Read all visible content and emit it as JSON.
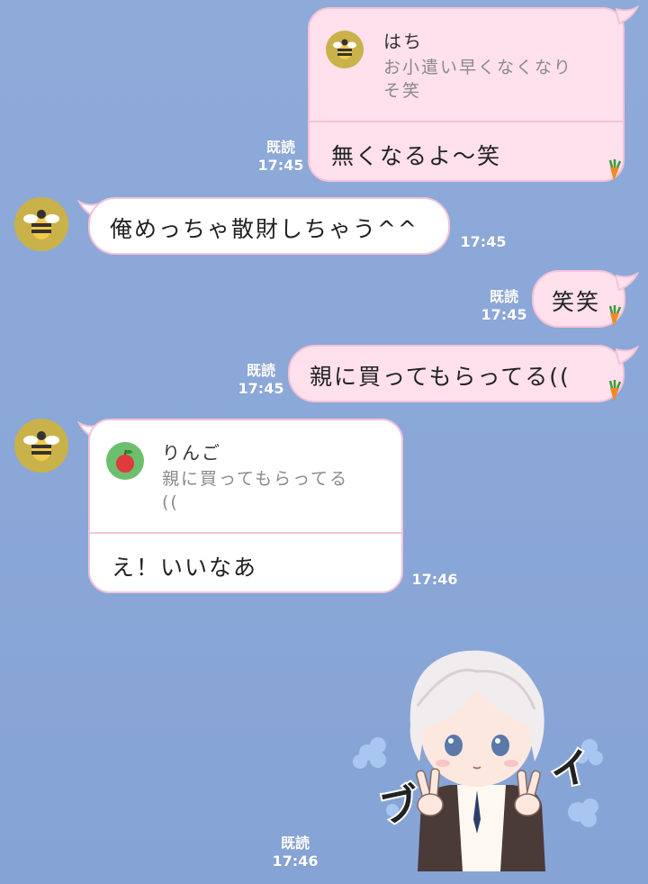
{
  "messages": [
    {
      "id": "m1",
      "side": "right",
      "quote": {
        "name": "はち",
        "text_line1": "お小遣い早くなくなり",
        "text_line2": "そ笑",
        "icon": "bee-icon"
      },
      "text": "無くなるよ～笑",
      "read": "既読",
      "time": "17:45"
    },
    {
      "id": "m2",
      "side": "left",
      "avatar": "bee-avatar",
      "text": "俺めっちゃ散財しちゃう^^",
      "time": "17:45"
    },
    {
      "id": "m3",
      "side": "right",
      "text": "笑笑",
      "read": "既読",
      "time": "17:45"
    },
    {
      "id": "m4",
      "side": "right",
      "text": "親に買ってもらってる((",
      "read": "既読",
      "time": "17:45"
    },
    {
      "id": "m5",
      "side": "left",
      "avatar": "bee-avatar",
      "quote": {
        "name": "りんご",
        "text_line1": "親に買ってもらってる",
        "text_line2": "((",
        "icon": "apple-icon"
      },
      "text": "え！いいなあ",
      "time": "17:46"
    },
    {
      "id": "m6",
      "side": "right",
      "type": "sticker",
      "sticker_text": "ブイ",
      "sticker": "boy-peace-sign-sticker",
      "read": "既読",
      "time": "17:46"
    }
  ],
  "colors": {
    "background": "#8aa7d8",
    "bubble_pink": "#ffe0ec",
    "bubble_white": "#ffffff",
    "bubble_border": "#f3c3d8",
    "bee": "#c9b249"
  }
}
